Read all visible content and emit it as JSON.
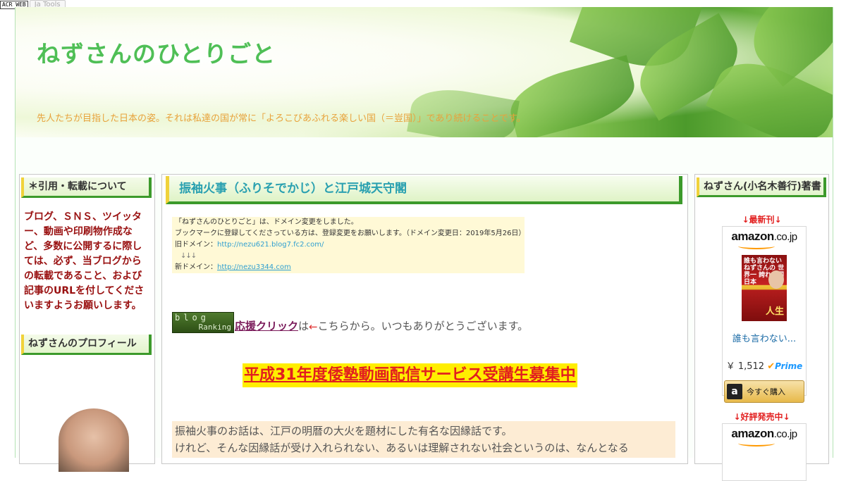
{
  "topbar": {
    "badge": "ACR WEB",
    "tools": "Ja Tools"
  },
  "header": {
    "title": "ねずさんのひとりごと",
    "description": "先人たちが目指した日本の姿。それは私達の国が常に「よろこびあふれる楽しい国（＝豈国）」であり続けることです。"
  },
  "left": {
    "notice_title": "＊引用・転載について",
    "notice_text": "ブログ、ＳＮＳ、ツイッター、動画や印刷物作成など、多数に公開するに際しては、必ず、当ブログからの転載であること、および記事のURLを付してくださいますようお願いします。",
    "profile_title": "ねずさんのプロフィール"
  },
  "entry": {
    "title": "振袖火事（ふりそでかじ）と江戸城天守閣",
    "notice": {
      "line1": "「ねずさんのひとりごと」は、ドメイン変更をしました。",
      "line2": "ブックマークに登録してくださっている方は、登録変更をお願いします。（ドメイン変更日：2019年5月26日）",
      "old_label": "旧ドメイン：",
      "old_url": "http://nezu621.blog7.fc2.com/",
      "arrows": "↓↓↓",
      "new_label": "新ドメイン：",
      "new_url": "http://nezu3344.com"
    },
    "ranking": {
      "badge_top": "blog",
      "badge_bottom": "Ranking",
      "link": "応援クリック",
      "ha": "は",
      "arrow": "←",
      "rest": "こちらから。いつもありがとうございます。"
    },
    "banner": "平成31年度倭塾動画配信サービス受講生募集中",
    "body_line1": "振袖火事のお話は、江戸の明暦の大火を題材にした有名な因縁話です。",
    "body_line2": "けれど、そんな因縁話が受け入れられない、あるいは理解されない社会というのは、なんとなる"
  },
  "right": {
    "title": "ねずさん(小名木善行)著書",
    "latest_label": "↓最新刊↓",
    "book_link": "誰も言わない...",
    "price": "￥ 1,512",
    "prime": "Prime",
    "buy_now": "今すぐ購入",
    "bestseller_label": "↓好評発売中↓",
    "amazon_logo": "amazon",
    "amazon_tld": ".co.jp",
    "book_cover_text": "誰も言わない ねずさんの 世界一 誇れる国 日本",
    "book_cover_sub": "人生"
  }
}
